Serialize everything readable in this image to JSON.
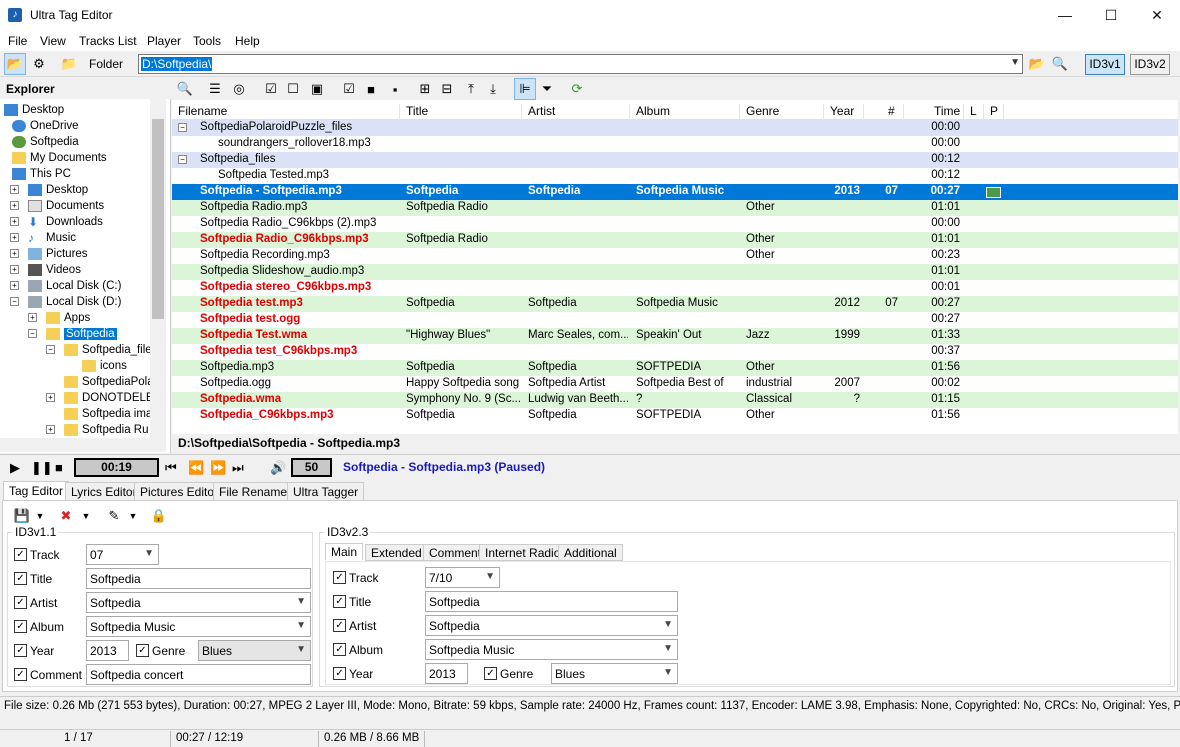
{
  "window": {
    "title": "Ultra Tag Editor"
  },
  "menu": [
    "File",
    "View",
    "Tracks List",
    "Player",
    "Tools",
    "Help"
  ],
  "toolbar": {
    "folder_label": "Folder",
    "folder_path": "D:\\Softpedia\\",
    "id3v1": "ID3v1",
    "id3v2": "ID3v2"
  },
  "explorer": {
    "title": "Explorer",
    "items": [
      "Desktop",
      "OneDrive",
      "Softpedia",
      "My Documents",
      "This PC",
      "Desktop",
      "Documents",
      "Downloads",
      "Music",
      "Pictures",
      "Videos",
      "Local Disk (C:)",
      "Local Disk (D:)",
      "Apps",
      "Softpedia",
      "Softpedia_file",
      "icons",
      "SoftpediaPola",
      "DONOTDELE",
      "Softpedia ima",
      "Softpedia Ru"
    ]
  },
  "table": {
    "headers": [
      "Filename",
      "Title",
      "Artist",
      "Album",
      "Genre",
      "Year",
      "#",
      "Time",
      "L",
      "P"
    ],
    "rows": [
      {
        "fn": "SoftpediaPolaroidPuzzle_files",
        "title": "",
        "artist": "",
        "album": "",
        "genre": "",
        "year": "",
        "num": "",
        "time": "00:00"
      },
      {
        "fn": "soundrangers_rollover18.mp3",
        "title": "",
        "artist": "",
        "album": "",
        "genre": "",
        "year": "",
        "num": "",
        "time": "00:00"
      },
      {
        "fn": "Softpedia_files",
        "title": "",
        "artist": "",
        "album": "",
        "genre": "",
        "year": "",
        "num": "",
        "time": "00:12"
      },
      {
        "fn": "Softpedia Tested.mp3",
        "title": "",
        "artist": "",
        "album": "",
        "genre": "",
        "year": "",
        "num": "",
        "time": "00:12"
      },
      {
        "fn": "Softpedia - Softpedia.mp3",
        "title": "Softpedia",
        "artist": "Softpedia",
        "album": "Softpedia Music",
        "genre": "",
        "year": "2013",
        "num": "07",
        "time": "00:27"
      },
      {
        "fn": "Softpedia Radio.mp3",
        "title": "Softpedia Radio",
        "artist": "",
        "album": "",
        "genre": "Other",
        "year": "",
        "num": "",
        "time": "01:01"
      },
      {
        "fn": "Softpedia Radio_C96kbps (2).mp3",
        "title": "",
        "artist": "",
        "album": "",
        "genre": "",
        "year": "",
        "num": "",
        "time": "00:00"
      },
      {
        "fn": "Softpedia Radio_C96kbps.mp3",
        "title": "Softpedia Radio",
        "artist": "",
        "album": "",
        "genre": "Other",
        "year": "",
        "num": "",
        "time": "01:01"
      },
      {
        "fn": "Softpedia Recording.mp3",
        "title": "",
        "artist": "",
        "album": "",
        "genre": "Other",
        "year": "",
        "num": "",
        "time": "00:23"
      },
      {
        "fn": "Softpedia Slideshow_audio.mp3",
        "title": "",
        "artist": "",
        "album": "",
        "genre": "",
        "year": "",
        "num": "",
        "time": "01:01"
      },
      {
        "fn": "Softpedia stereo_C96kbps.mp3",
        "title": "",
        "artist": "",
        "album": "",
        "genre": "",
        "year": "",
        "num": "",
        "time": "00:01"
      },
      {
        "fn": "Softpedia test.mp3",
        "title": "Softpedia",
        "artist": "Softpedia",
        "album": "Softpedia Music",
        "genre": "",
        "year": "2012",
        "num": "07",
        "time": "00:27"
      },
      {
        "fn": "Softpedia test.ogg",
        "title": "",
        "artist": "",
        "album": "",
        "genre": "",
        "year": "",
        "num": "",
        "time": "00:27"
      },
      {
        "fn": "Softpedia Test.wma",
        "title": "\"Highway Blues\"",
        "artist": "Marc Seales, com...",
        "album": "Speakin' Out",
        "genre": "Jazz",
        "year": "1999",
        "num": "",
        "time": "01:33"
      },
      {
        "fn": "Softpedia test_C96kbps.mp3",
        "title": "",
        "artist": "",
        "album": "",
        "genre": "",
        "year": "",
        "num": "",
        "time": "00:37"
      },
      {
        "fn": "Softpedia.mp3",
        "title": "Softpedia",
        "artist": "Softpedia",
        "album": "SOFTPEDIA",
        "genre": "Other",
        "year": "",
        "num": "",
        "time": "01:56"
      },
      {
        "fn": "Softpedia.ogg",
        "title": "Happy Softpedia song",
        "artist": "Softpedia Artist",
        "album": "Softpedia Best of",
        "genre": "industrial",
        "year": "2007",
        "num": "",
        "time": "00:02"
      },
      {
        "fn": "Softpedia.wma",
        "title": "Symphony No. 9 (Sc...",
        "artist": "Ludwig van Beeth...",
        "album": "?",
        "genre": "Classical",
        "year": "?",
        "num": "",
        "time": "01:15"
      },
      {
        "fn": "Softpedia_C96kbps.mp3",
        "title": "Softpedia",
        "artist": "Softpedia",
        "album": "SOFTPEDIA",
        "genre": "Other",
        "year": "",
        "num": "",
        "time": "01:56"
      }
    ]
  },
  "path_bar": "D:\\Softpedia\\Softpedia - Softpedia.mp3",
  "player": {
    "position": "00:19",
    "volume": "50",
    "now_playing": "Softpedia - Softpedia.mp3 (Paused)"
  },
  "tabs": [
    "Tag Editor",
    "Lyrics Editor",
    "Pictures Editor",
    "File Renamer",
    "Ultra Tagger"
  ],
  "id3v1": {
    "label": "ID3v1.1",
    "track_label": "Track",
    "track": "07",
    "title_label": "Title",
    "title": "Softpedia",
    "artist_label": "Artist",
    "artist": "Softpedia",
    "album_label": "Album",
    "album": "Softpedia Music",
    "year_label": "Year",
    "year": "2013",
    "genre_label": "Genre",
    "genre": "Blues",
    "comment_label": "Comment",
    "comment": "Softpedia concert"
  },
  "id3v2": {
    "label": "ID3v2.3",
    "tabs": [
      "Main",
      "Extended",
      "Comment",
      "Internet Radio",
      "Additional"
    ],
    "track_label": "Track",
    "track": "7/10",
    "title_label": "Title",
    "title": "Softpedia",
    "artist_label": "Artist",
    "artist": "Softpedia",
    "album_label": "Album",
    "album": "Softpedia Music",
    "year_label": "Year",
    "year": "2013",
    "genre_label": "Genre",
    "genre": "Blues"
  },
  "file_info": "File size: 0.26 Mb (271 553 bytes),  Duration: 00:27,  MPEG 2 Layer III,  Mode: Mono,  Bitrate: 59 kbps,  Sample rate: 24000 Hz,  Frames count: 1137,  Encoder: LAME 3.98,  Emphasis: None,  Copyrighted: No,  CRCs: No,  Original: Yes,  Private: No",
  "status": {
    "count": "1 / 17",
    "time": "00:27 / 12:19",
    "size": "0.26 MB / 8.66 MB"
  }
}
